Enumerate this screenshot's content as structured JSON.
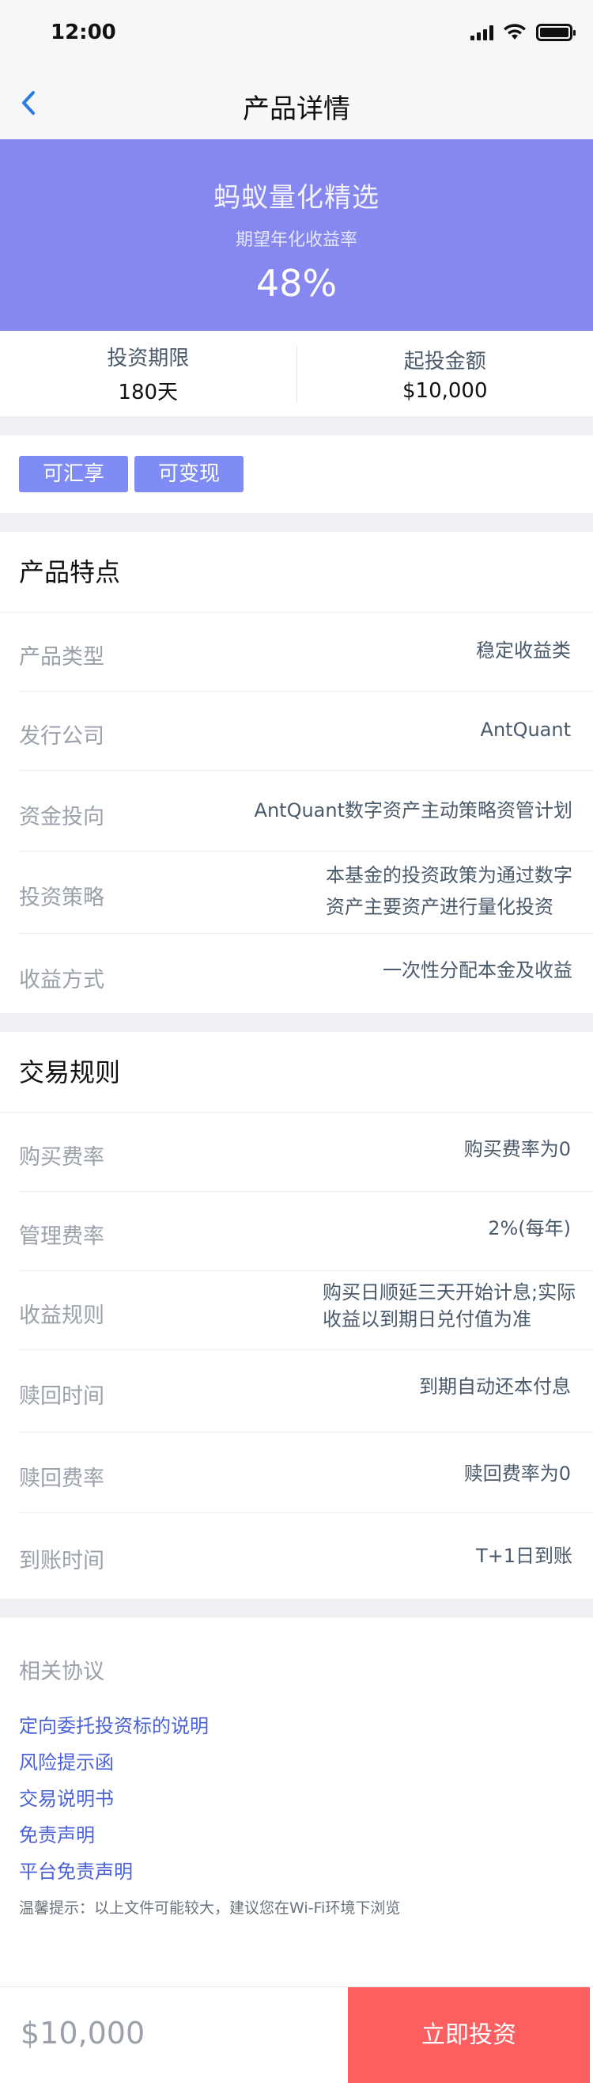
{
  "status_bar": {
    "time": "12:00"
  },
  "nav": {
    "title": "产品详情"
  },
  "hero": {
    "name": "蚂蚁量化精选",
    "subtitle": "期望年化收益率",
    "rate": "48%"
  },
  "terms": [
    {
      "label": "投资期限",
      "value": "180天"
    },
    {
      "label": "起投金额",
      "value": "$10,000"
    }
  ],
  "tags": [
    "可汇享",
    "可变现"
  ],
  "features": {
    "title": "产品特点",
    "rows": [
      {
        "label": "产品类型",
        "value": "稳定收益类"
      },
      {
        "label": "发行公司",
        "value": "AntQuant"
      },
      {
        "label": "资金投向",
        "value": "AntQuant数字资产主动策略资管计划"
      },
      {
        "label": "投资策略",
        "value_line1": "本基金的投资政策为通过数字",
        "value_line2": "资产主要资产进行量化投资"
      },
      {
        "label": "收益方式",
        "value": "一次性分配本金及收益"
      }
    ]
  },
  "rules": {
    "title": "交易规则",
    "rows": [
      {
        "label": "购买费率",
        "value": "购买费率为0"
      },
      {
        "label": "管理费率",
        "value": "2%(每年)"
      },
      {
        "label": "收益规则",
        "value_line1": "购买日顺延三天开始计息;实际",
        "value_line2": "收益以到期日兑付值为准"
      },
      {
        "label": "赎回时间",
        "value": "到期自动还本付息"
      },
      {
        "label": "赎回费率",
        "value": "赎回费率为0"
      },
      {
        "label": "到账时间",
        "value": "T+1日到账"
      }
    ]
  },
  "agreement": {
    "title": "相关协议",
    "links": [
      "定向委托投资标的说明",
      "风险提示函",
      "交易说明书",
      "免责声明",
      "平台免责声明"
    ],
    "tip": "温馨提示：以上文件可能较大，建议您在Wi-Fi环境下浏览"
  },
  "bottom": {
    "amount": "$10,000",
    "button": "立即投资"
  },
  "colors": {
    "hero_bg": "#8787f0",
    "tag_bg": "#7f8cf6",
    "link": "#4a62d6",
    "cta": "#fd5f60"
  }
}
